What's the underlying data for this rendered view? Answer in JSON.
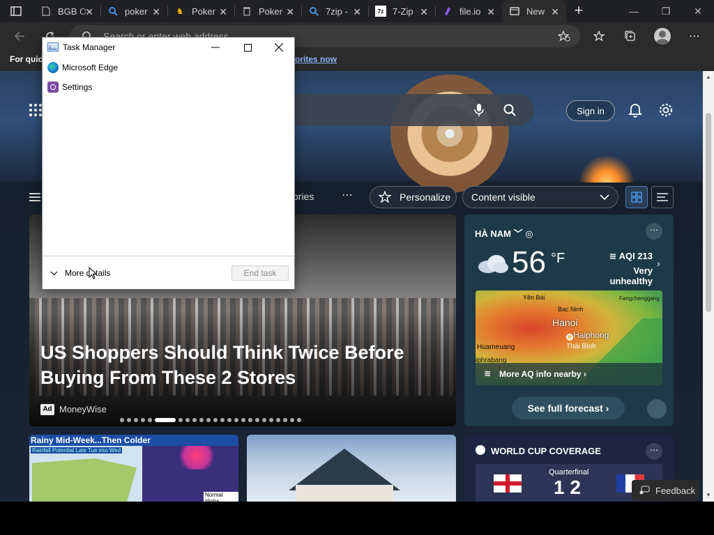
{
  "browser": {
    "tabs": [
      {
        "title": "BGB O",
        "icon": "page-icon",
        "active": false
      },
      {
        "title": "poker",
        "icon": "search-icon",
        "active": false
      },
      {
        "title": "Poker",
        "icon": "poker-site-icon",
        "active": false
      },
      {
        "title": "Poker",
        "icon": "trash-page-icon",
        "active": false
      },
      {
        "title": "7zip -",
        "icon": "search-icon",
        "active": false
      },
      {
        "title": "7-Zip",
        "icon": "sevenzip-icon",
        "active": false
      },
      {
        "title": "file.io",
        "icon": "fileio-icon",
        "active": false
      },
      {
        "title": "New",
        "icon": "newtab-icon",
        "active": true
      }
    ],
    "address_placeholder": "Search or enter web address",
    "favorites_label": "For quick",
    "favorites_link": "orites now"
  },
  "page": {
    "sign_in": "Sign in",
    "nav_text": "ories",
    "personalize": "Personalize",
    "content_visible": "Content visible",
    "hero": {
      "headline": "US Shoppers Should Think Twice Before Buying From These 2 Stores",
      "ad": "Ad",
      "source": "MoneyWise",
      "slide_count": 24,
      "active_slide": 5
    },
    "weather": {
      "location": "HÀ NAM",
      "temperature": "56",
      "unit": "°F",
      "aqi": "AQI 213",
      "aqi_status": "Very unhealthy",
      "map_labels": {
        "yen_bai": "Yên Bái",
        "bac_ninh": "Bac Ninh",
        "fangcheng": "Fangchenggang",
        "hanoi": "Hanoi",
        "haiphong": "Haiphong",
        "thai_binh": "Thái Bình",
        "huameuang": "Huameuang",
        "phabang": "iphrabang"
      },
      "more_aq": "More AQ info nearby",
      "forecast_button": "See full forecast"
    },
    "card_rain": {
      "title": "Rainy Mid-Week...Then Colder",
      "subtitle": "Rainfall Potential Late Tue into Wed",
      "normal_highs": "Normal Highs"
    },
    "world_cup": {
      "title": "WORLD CUP COVERAGE",
      "stage": "Quarterfinal",
      "score": "1 2"
    },
    "feedback": "Feedback"
  },
  "taskmgr": {
    "title": "Task Manager",
    "processes": [
      "Microsoft Edge",
      "Settings"
    ],
    "more_details": "More details",
    "end_task": "End task"
  }
}
